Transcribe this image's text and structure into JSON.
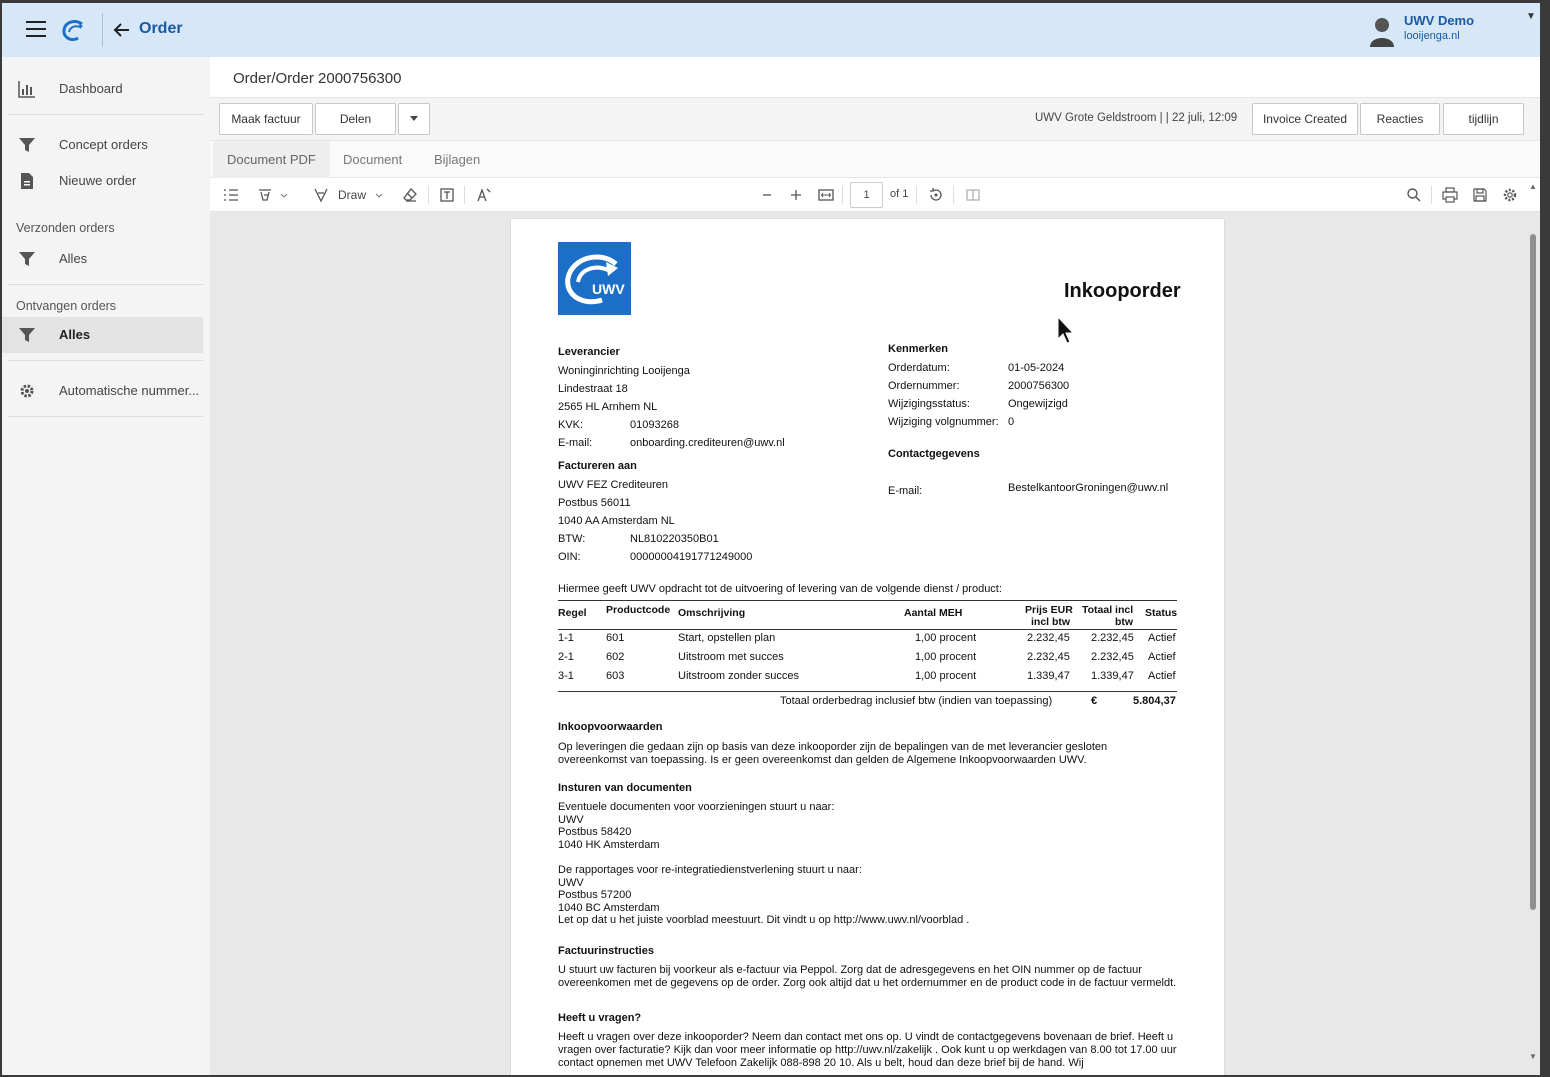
{
  "header": {
    "title": "Order",
    "user_name": "UWV Demo",
    "user_domain": "looijenga.nl"
  },
  "sidebar": {
    "items": [
      {
        "label": "Dashboard",
        "icon": "chart-icon"
      },
      {
        "label": "Concept orders",
        "icon": "filter-icon"
      },
      {
        "label": "Nieuwe order",
        "icon": "document-icon"
      },
      {
        "label": "Alles",
        "icon": "filter-icon"
      },
      {
        "label": "Alles",
        "icon": "filter-icon"
      },
      {
        "label": "Automatische nummer...",
        "icon": "gear-icon"
      }
    ],
    "sections": [
      "Verzonden orders",
      "Ontvangen orders"
    ]
  },
  "main": {
    "breadcrumb": "Order/Order 2000756300",
    "toolbar": {
      "invoice_button": "Maak factuur",
      "share_button": "Delen",
      "status": "UWV Grote Geldstroom | | 22 juli, 12:09",
      "status_button": "Invoice Created",
      "reactions_button": "Reacties",
      "timeline_button": "tijdlijn"
    },
    "tabs": [
      "Document PDF",
      "Document",
      "Bijlagen"
    ],
    "pdf_toolbar": {
      "draw_label": "Draw",
      "page_number": "1",
      "page_total": "of 1"
    }
  },
  "document": {
    "logo_text": "UWV",
    "title": "Inkooporder",
    "supplier": {
      "heading": "Leverancier",
      "name": "Woninginrichting Looijenga",
      "street": "Lindestraat 18",
      "city": "2565 HL Arnhem NL",
      "kvk_label": "KVK:",
      "kvk": "01093268",
      "email_label": "E-mail:",
      "email": "onboarding.crediteuren@uwv.nl"
    },
    "billing": {
      "heading": "Factureren aan",
      "name": "UWV FEZ Crediteuren",
      "postbus": "Postbus 56011",
      "city": "1040 AA Amsterdam NL",
      "btw_label": "BTW:",
      "btw": "NL810220350B01",
      "oin_label": "OIN:",
      "oin": "00000004191771249000"
    },
    "features": {
      "heading": "Kenmerken",
      "rows": [
        {
          "label": "Orderdatum:",
          "value": "01-05-2024"
        },
        {
          "label": "Ordernummer:",
          "value": "2000756300"
        },
        {
          "label": "Wijzigingsstatus:",
          "value": "Ongewijzigd"
        },
        {
          "label": "Wijziging volgnummer:",
          "value": "0"
        }
      ]
    },
    "contact": {
      "heading": "Contactgegevens",
      "email_label": "E-mail:",
      "email": "BestelkantoorGroningen@uwv.nl"
    },
    "intro": "Hiermee geeft UWV opdracht tot de uitvoering of levering van de volgende dienst / product:",
    "table": {
      "headers": {
        "regel": "Regel",
        "productcode": "Productcode",
        "omschrijving": "Omschrijving",
        "aantal": "Aantal MEH",
        "prijs1": "Prijs EUR",
        "prijs2": "incl btw",
        "totaal1": "Totaal incl",
        "totaal2": "btw",
        "status": "Status"
      },
      "rows": [
        {
          "regel": "1-1",
          "code": "601",
          "omschrijving": "Start, opstellen plan",
          "aantal": "1,00 procent",
          "prijs": "2.232,45",
          "totaal": "2.232,45",
          "status": "Actief"
        },
        {
          "regel": "2-1",
          "code": "602",
          "omschrijving": "Uitstroom met succes",
          "aantal": "1,00 procent",
          "prijs": "2.232,45",
          "totaal": "2.232,45",
          "status": "Actief"
        },
        {
          "regel": "3-1",
          "code": "603",
          "omschrijving": "Uitstroom zonder succes",
          "aantal": "1,00 procent",
          "prijs": "1.339,47",
          "totaal": "1.339,47",
          "status": "Actief"
        }
      ],
      "total_label": "Totaal orderbedrag inclusief btw (indien van toepassing)",
      "currency": "€",
      "total": "5.804,37"
    },
    "terms": {
      "heading": "Inkoopvoorwaarden",
      "text": "Op leveringen die gedaan zijn op basis van deze inkooporder zijn de bepalingen van de met leverancier gesloten overeenkomst van toepassing. Is er geen overeenkomst dan gelden de Algemene Inkoopvoorwaarden UWV."
    },
    "documents": {
      "heading": "Insturen van documenten",
      "block1": [
        "Eventuele documenten voor voorzieningen stuurt u naar:",
        "UWV",
        "Postbus 58420",
        "1040 HK Amsterdam"
      ],
      "block2": [
        "De rapportages voor re-integratiedienstverlening stuurt u naar:",
        "UWV",
        "Postbus 57200",
        "1040 BC Amsterdam",
        "Let op dat u het juiste voorblad meestuurt. Dit vindt u op http://www.uwv.nl/voorblad ."
      ]
    },
    "invoice_instructions": {
      "heading": "Factuurinstructies",
      "text": "U stuurt uw facturen bij voorkeur als e-factuur via Peppol. Zorg dat de adresgegevens en het OIN nummer op de factuur overeenkomen met de gegevens op de order. Zorg ook altijd dat u het ordernummer en de product code in de factuur vermeldt."
    },
    "questions": {
      "heading": "Heeft u vragen?",
      "text": "Heeft u vragen over deze inkooporder? Neem dan contact met ons op. U vindt de contactgegevens bovenaan de brief. Heeft u vragen over facturatie? Kijk dan voor meer informatie op http://uwv.nl/zakelijk . Ook kunt u op werkdagen van 8.00 tot 17.00 uur contact opnemen met UWV Telefoon Zakelijk 088-898 20 10. Als u belt, houd dan deze brief bij de hand. Wij"
    }
  },
  "colors": {
    "topbar": "#d6e8f7",
    "brand_blue": "#1b5aa0",
    "logo_blue": "#1b6fc8"
  }
}
